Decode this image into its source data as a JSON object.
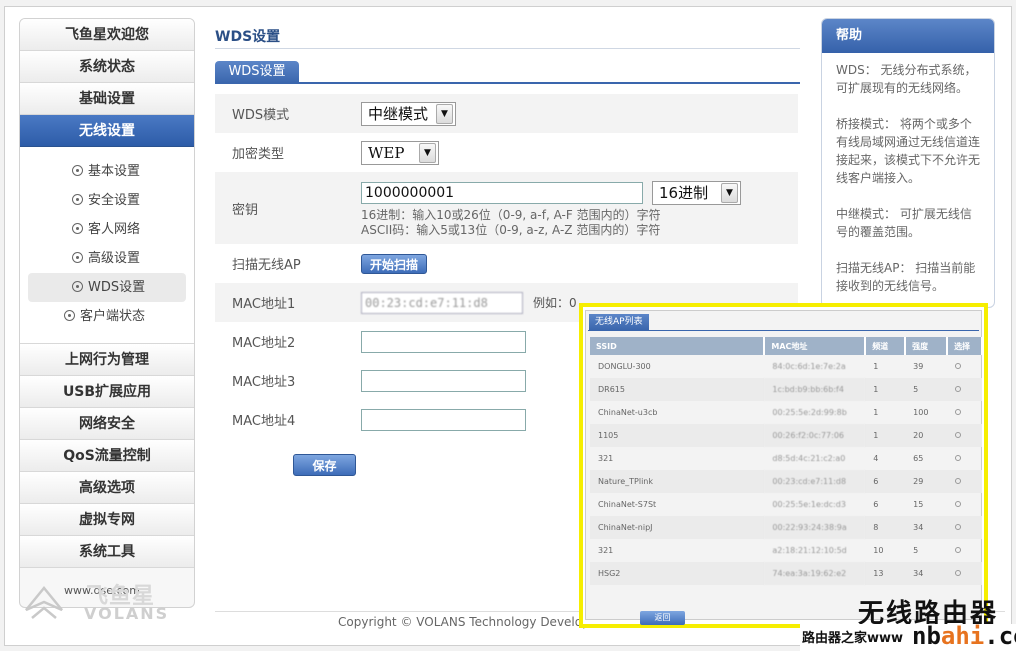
{
  "nav": {
    "top": [
      "飞鱼星欢迎您",
      "系统状态",
      "基础设置"
    ],
    "active": "无线设置",
    "sub": [
      "基本设置",
      "安全设置",
      "客人网络",
      "高级设置",
      "WDS设置",
      "客户端状态"
    ],
    "current_sub": "WDS设置",
    "bottom": [
      "上网行为管理",
      "USB扩展应用",
      "网络安全",
      "QoS流量控制",
      "高级选项",
      "虚拟专网",
      "系统工具"
    ]
  },
  "logo": {
    "site": "www.dse.com",
    "brand": "飞鱼星",
    "brand_en": "VOLANS"
  },
  "main": {
    "title": "WDS设置",
    "tab": "WDS设置",
    "wds_mode_label": "WDS模式",
    "wds_mode_value": "中继模式",
    "enc_label": "加密类型",
    "enc_value": "WEP",
    "key_label": "密钥",
    "key_value": "1000000001",
    "key_format": "16进制",
    "hint_hex": "16进制：输入10或26位（0-9, a-f, A-F 范围内的）字符",
    "hint_ascii": "ASCII码：输入5或13位（0-9, a-z, A-Z 范围内的）字符",
    "scan_label": "扫描无线AP",
    "scan_button": "开始扫描",
    "mac1_label": "MAC地址1",
    "mac1_value": "00:23:cd:e7:11:d8",
    "example": "例如：0",
    "mac2_label": "MAC地址2",
    "mac3_label": "MAC地址3",
    "mac4_label": "MAC地址4",
    "save_button": "保存"
  },
  "copyright": "Copyright © VOLANS Technology Develop",
  "help": {
    "title": "帮助",
    "p1": "WDS：  无线分布式系统，可扩展现有的无线网络。",
    "p2": "桥接模式：  将两个或多个有线局域网通过无线信道连接起来，该模式下不允许无线客户端接入。",
    "p3": "中继模式：  可扩展无线信号的覆盖范围。",
    "p4": "扫描无线AP：  扫描当前能接收到的无线信号。"
  },
  "ap_popup": {
    "tab": "无线AP列表",
    "headers": [
      "SSID",
      "MAC地址",
      "频道",
      "强度",
      "选择"
    ],
    "rows": [
      [
        "DONGLU-300",
        "84:0c:6d:1e:7e:2a",
        "1",
        "39"
      ],
      [
        "DR615",
        "1c:bd:b9:bb:6b:f4",
        "1",
        "5"
      ],
      [
        "ChinaNet-u3cb",
        "00:25:5e:2d:99:8b",
        "1",
        "100"
      ],
      [
        "1105",
        "00:26:f2:0c:77:06",
        "1",
        "20"
      ],
      [
        "321",
        "d8:5d:4c:21:c2:a0",
        "4",
        "65"
      ],
      [
        "Nature_TPlink",
        "00:23:cd:e7:11:d8",
        "6",
        "29"
      ],
      [
        "ChinaNet-S7St",
        "00:25:5e:1e:dc:d3",
        "6",
        "15"
      ],
      [
        "ChinaNet-nipJ",
        "00:22:93:24:38:9a",
        "8",
        "34"
      ],
      [
        "321",
        "a2:18:21:12:10:5d",
        "10",
        "5"
      ],
      [
        "HSG2",
        "74:ea:3a:19:62:e2",
        "13",
        "34"
      ]
    ],
    "back_button": "返回"
  },
  "watermark": {
    "line1": "无线路由器",
    "line2": "路由器之家www",
    "site_a": "nb",
    "site_b": "ahi",
    "site_c": ".com"
  }
}
